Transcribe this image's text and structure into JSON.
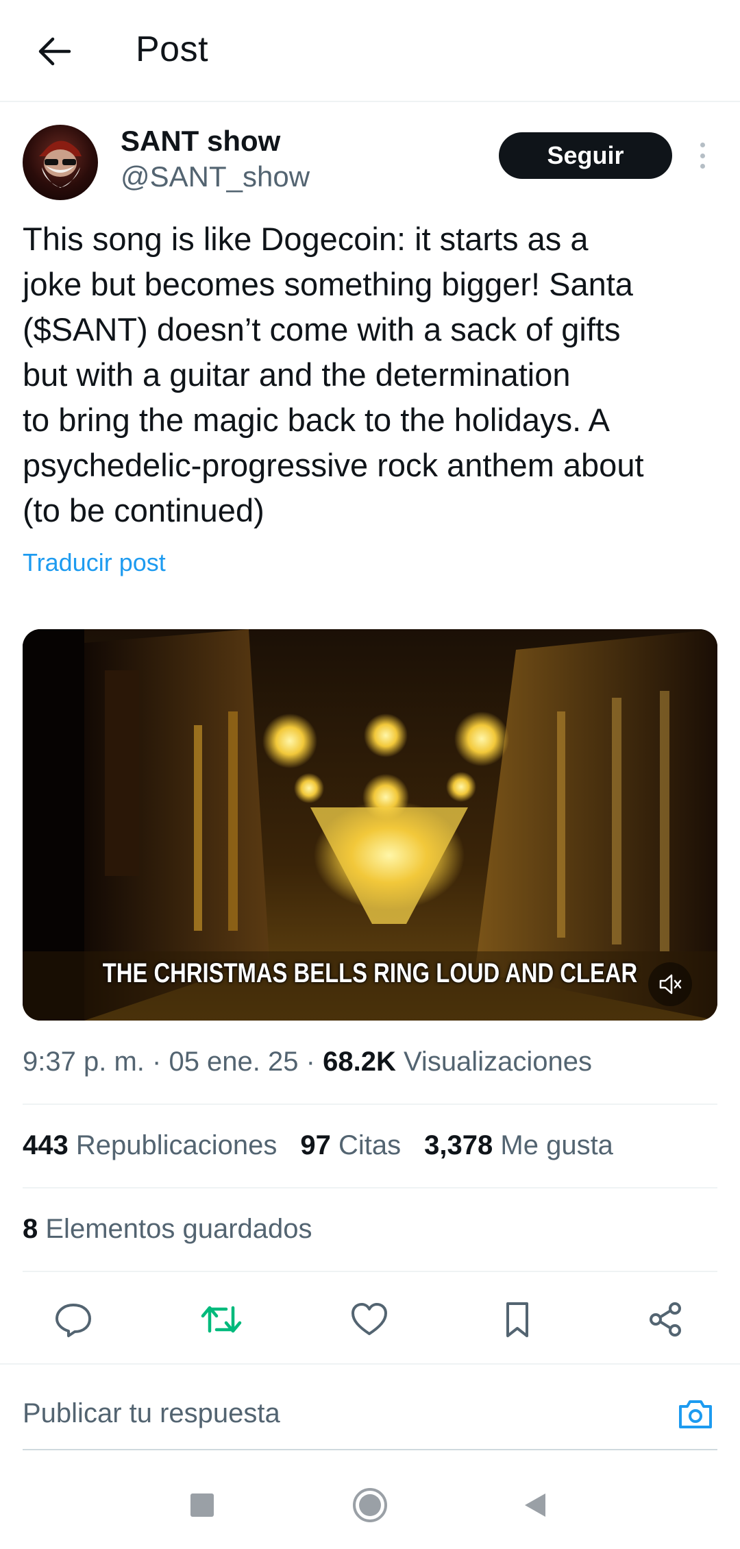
{
  "header": {
    "title": "Post"
  },
  "author": {
    "display_name": "SANT show",
    "handle": "@SANT_show",
    "follow_label": "Seguir"
  },
  "post": {
    "text": "This song is like Dogecoin: it starts as a\njoke but becomes something bigger! Santa\n($SANT) doesn’t come with a sack of gifts\nbut with a guitar and the determination\nto bring the magic back to the holidays. A\npsychedelic-progressive rock anthem about\n(to be continued)",
    "translate_label": "Traducir post",
    "video_subtitle": "THE CHRISTMAS BELLS RING LOUD AND CLEAR",
    "time": "9:37 p. m.",
    "date": "05 ene. 25",
    "views_count": "68.2K",
    "views_label": "Visualizaciones",
    "separator": "·"
  },
  "stats": {
    "reposts_count": "443",
    "reposts_label": "Republicaciones",
    "quotes_count": "97",
    "quotes_label": "Citas",
    "likes_count": "3,378",
    "likes_label": "Me gusta",
    "saved_count": "8",
    "saved_label": "Elementos guardados"
  },
  "actions": [
    {
      "icon": "reply-icon"
    },
    {
      "icon": "repost-icon",
      "color": "#00ba7c"
    },
    {
      "icon": "like-icon"
    },
    {
      "icon": "bookmark-icon"
    },
    {
      "icon": "share-icon"
    }
  ],
  "reply": {
    "placeholder": "Publicar tu respuesta",
    "camera_color": "#1d9bf0"
  },
  "colors": {
    "link": "#1d9bf0",
    "secondary_text": "#536471",
    "follow_button": "#0f1419"
  }
}
